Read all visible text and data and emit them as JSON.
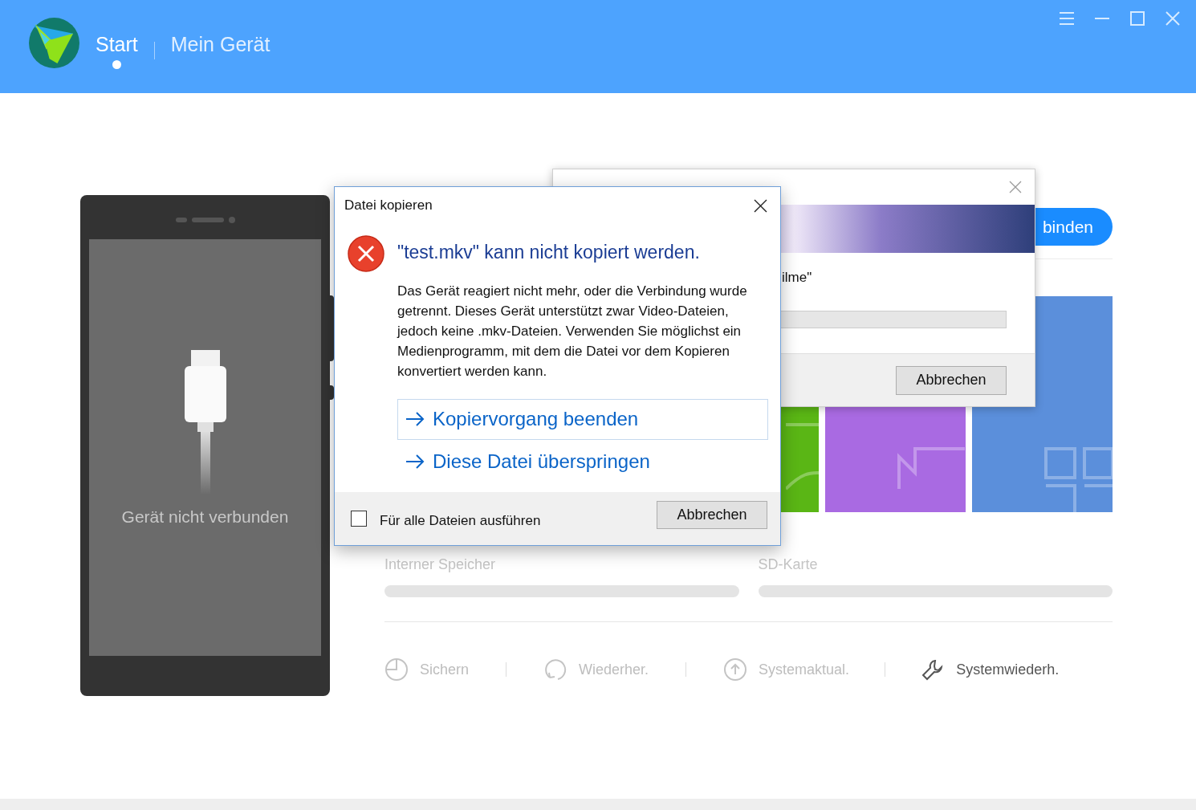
{
  "header": {
    "nav": [
      {
        "label": "Start",
        "selected": true
      },
      {
        "label": "Mein Gerät",
        "selected": false
      }
    ]
  },
  "phone": {
    "status": "Gerät nicht verbunden"
  },
  "connect_button": {
    "label": "binden"
  },
  "tiles": [
    {
      "color": "#5ab615"
    },
    {
      "color": "#a96ae2"
    },
    {
      "color": "#5b8fdb"
    }
  ],
  "storage": [
    {
      "label": "Interner Speicher",
      "level": 0
    },
    {
      "label": "SD-Karte",
      "level": 0
    }
  ],
  "tools": [
    {
      "kind": "backup",
      "label": "Sichern",
      "disabled": true
    },
    {
      "kind": "restore",
      "label": "Wiederher.",
      "disabled": true
    },
    {
      "kind": "update",
      "label": "Systemaktual.",
      "disabled": true
    },
    {
      "kind": "repair",
      "label": "Systemwiederh.",
      "disabled": false
    }
  ],
  "copy_window": {
    "text": "ilme\"",
    "progress": {
      "level": 0
    },
    "cancel": "Abbrechen"
  },
  "dialog": {
    "title": "Datei kopieren",
    "heading": "\"test.mkv\" kann nicht kopiert werden.",
    "message": "Das Gerät reagiert nicht mehr, oder die Verbindung wurde getrennt. Dieses Gerät unterstützt zwar Video-Dateien, jedoch keine .mkv-Dateien. Verwenden Sie möglichst ein Medienprogramm, mit dem die Datei vor dem Kopieren konvertiert werden kann.",
    "options": [
      {
        "label": "Kopiervorgang beenden",
        "selected": true
      },
      {
        "label": "Diese Datei überspringen",
        "selected": false
      }
    ],
    "checkbox": {
      "label": "Für alle Dateien ausführen",
      "checked": false
    },
    "cancel": "Abbrechen"
  }
}
